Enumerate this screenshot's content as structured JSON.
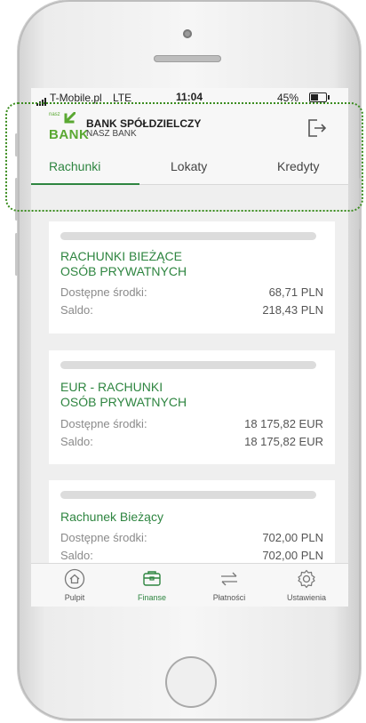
{
  "colors": {
    "accent": "#2e8540",
    "logo_green": "#5aa832",
    "frame": "#3a8c1e"
  },
  "statusbar": {
    "carrier": "T-Mobile.pl",
    "network": "LTE",
    "time": "11:04",
    "battery": "45%"
  },
  "header": {
    "logo_small": "nasz",
    "logo_big": "BANK",
    "bank_name": "BANK SPÓŁDZIELCZY",
    "bank_sub": "NASZ BANK",
    "logout_icon": "logout-icon"
  },
  "tabs": [
    {
      "label": "Rachunki",
      "active": true
    },
    {
      "label": "Lokaty",
      "active": false
    },
    {
      "label": "Kredyty",
      "active": false
    }
  ],
  "accounts": [
    {
      "title_line1": "RACHUNKI BIEŻĄCE",
      "title_line2": "OSÓB PRYWATNYCH",
      "available_label": "Dostępne środki:",
      "available_value": "68,71 PLN",
      "balance_label": "Saldo:",
      "balance_value": "218,43 PLN"
    },
    {
      "title_line1": "EUR - RACHUNKI",
      "title_line2": "OSÓB PRYWATNYCH",
      "available_label": "Dostępne środki:",
      "available_value": "18 175,82 EUR",
      "balance_label": "Saldo:",
      "balance_value": "18 175,82 EUR"
    },
    {
      "title_line1": "Rachunek Bieżący",
      "title_line2": "",
      "available_label": "Dostępne środki:",
      "available_value": "702,00 PLN",
      "balance_label": "Saldo:",
      "balance_value": "702,00 PLN"
    }
  ],
  "bottom_nav": [
    {
      "label": "Pulpit",
      "icon": "home-icon",
      "active": false
    },
    {
      "label": "Finanse",
      "icon": "wallet-icon",
      "active": true
    },
    {
      "label": "Płatności",
      "icon": "transfer-icon",
      "active": false
    },
    {
      "label": "Ustawienia",
      "icon": "gear-icon",
      "active": false
    }
  ]
}
